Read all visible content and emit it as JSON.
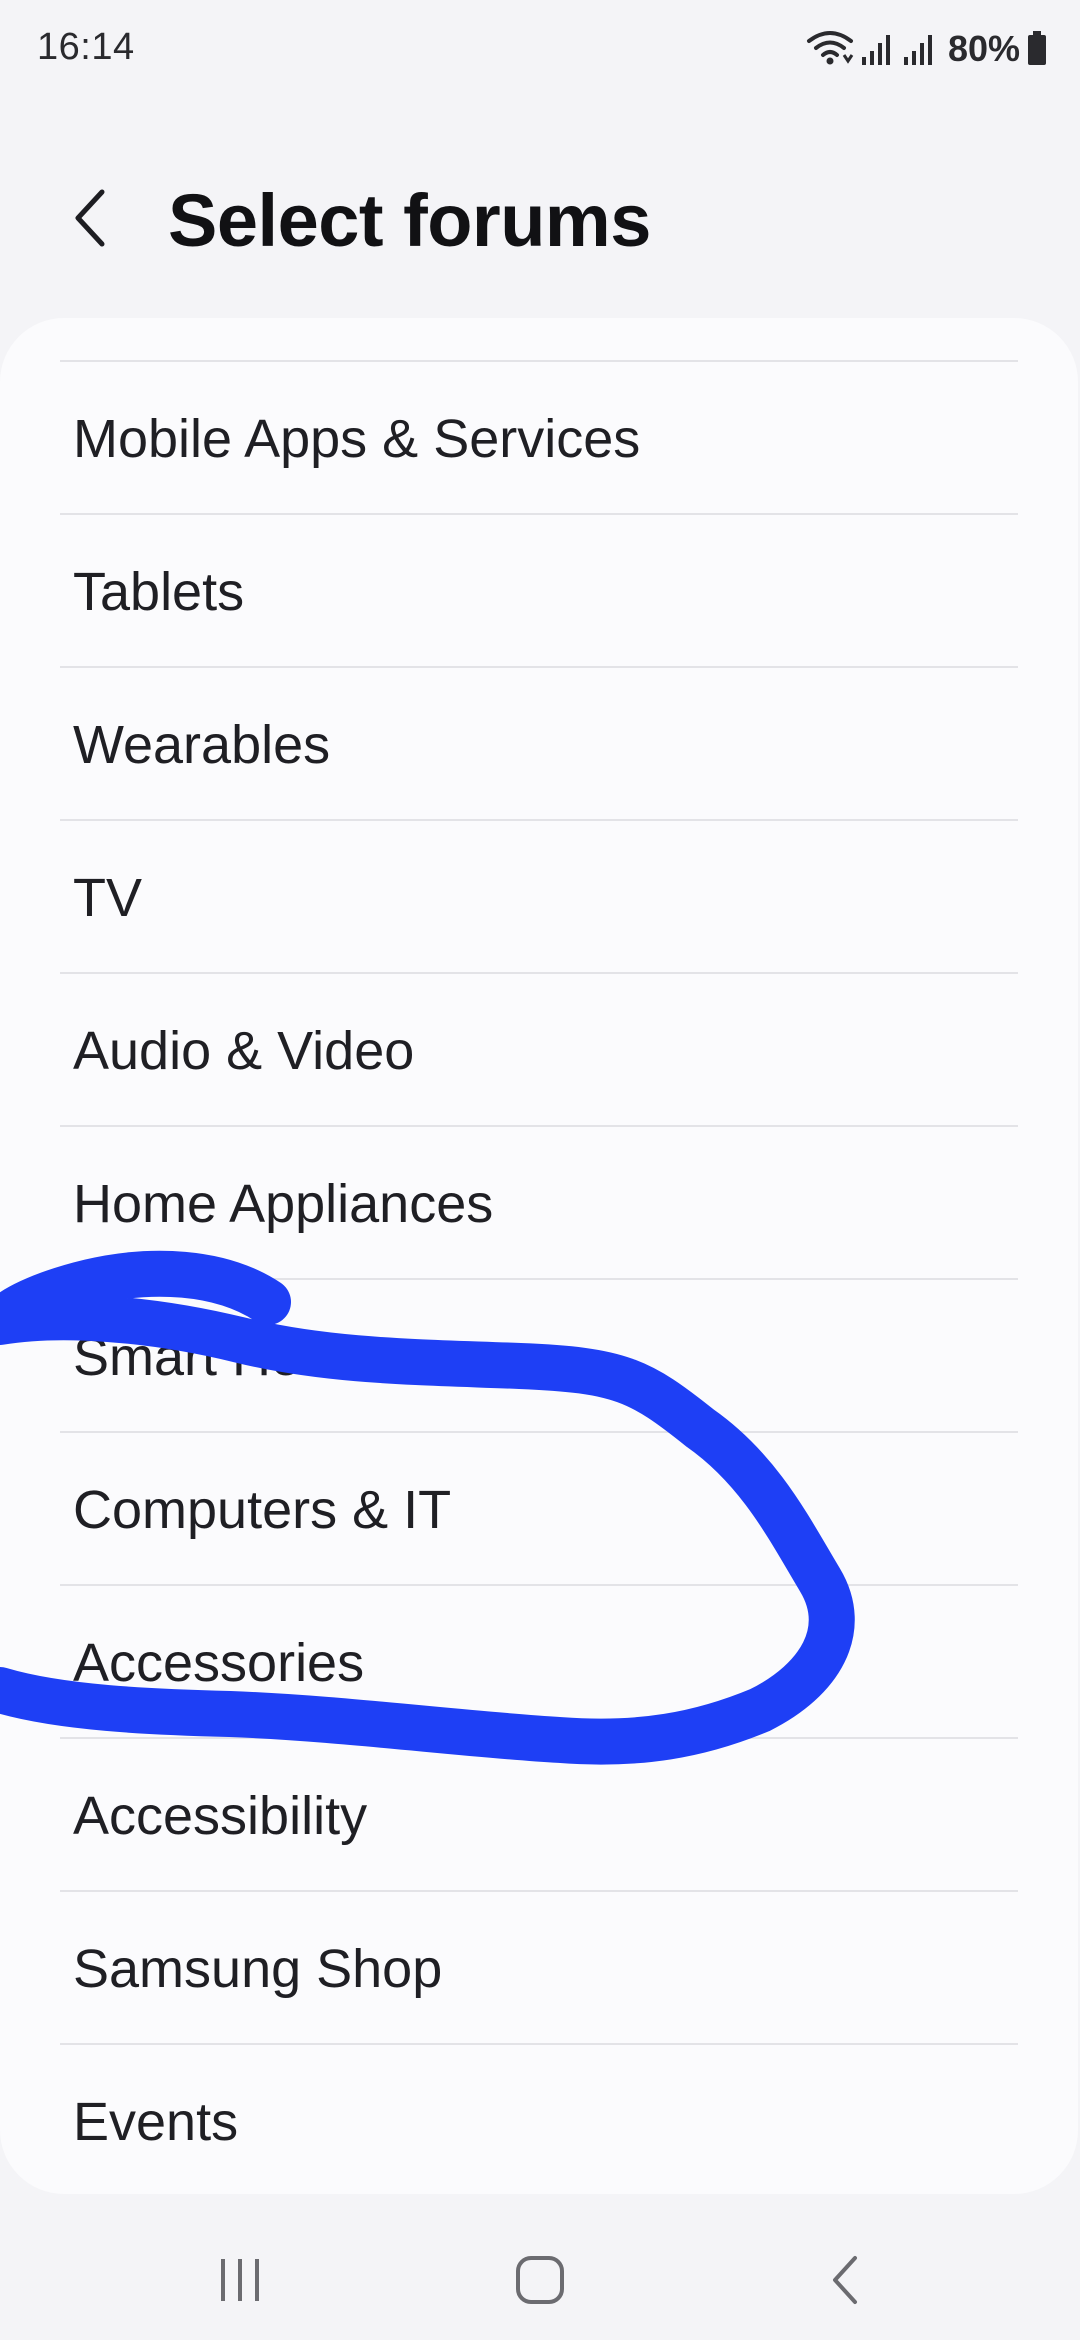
{
  "status_bar": {
    "time": "16:14",
    "battery": "80%",
    "icons": [
      "wifi-icon",
      "signal-icon",
      "signal-icon",
      "battery-icon"
    ]
  },
  "header": {
    "title": "Select forums",
    "back_icon": "chevron-left-icon"
  },
  "forums": [
    {
      "label": "Mobile Apps & Services"
    },
    {
      "label": "Tablets"
    },
    {
      "label": "Wearables"
    },
    {
      "label": "TV"
    },
    {
      "label": "Audio & Video"
    },
    {
      "label": "Home Appliances"
    },
    {
      "label": "Smart Home"
    },
    {
      "label": "Computers & IT"
    },
    {
      "label": "Accessories"
    },
    {
      "label": "Accessibility"
    },
    {
      "label": "Samsung Shop"
    },
    {
      "label": "Events"
    }
  ],
  "annotation": {
    "color": "#1e3ff5"
  },
  "nav_bar": {
    "icons": [
      "recent-apps-icon",
      "home-icon",
      "back-icon"
    ]
  }
}
